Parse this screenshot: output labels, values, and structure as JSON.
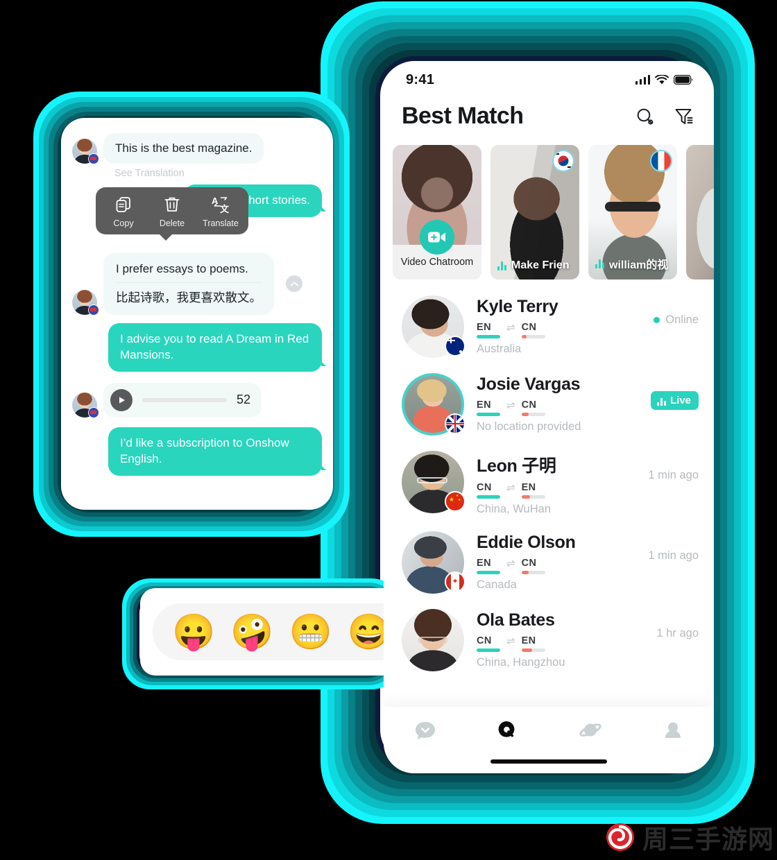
{
  "accent": {
    "teal": "#2AD5BE",
    "neon_cyan": "#18F0F6",
    "deep_teal": "#0B4B4B",
    "navy": "#0B1430",
    "red": "#F4796B"
  },
  "right_phone": {
    "status_bar": {
      "time": "9:41",
      "signal_icon": "cellular-signal-icon",
      "wifi_icon": "wifi-icon",
      "battery_icon": "battery-icon"
    },
    "header": {
      "title": "Best Match",
      "search_icon": "search-icon",
      "filter_icon": "filter-icon"
    },
    "stories": [
      {
        "label": "Video Chatroom",
        "type": "video-chatroom",
        "button_icon": "video-plus-icon",
        "flag": null,
        "live": false
      },
      {
        "label": "Make Frien",
        "type": "live",
        "flag": "kr",
        "live": true
      },
      {
        "label": "william的视",
        "type": "live",
        "flag": "fr",
        "live": true
      },
      {
        "label": "",
        "type": "partial",
        "flag": null,
        "live": false
      }
    ],
    "users": [
      {
        "name": "Kyle Terry",
        "from": "EN",
        "to": "CN",
        "from_level": 100,
        "to_level": 22,
        "location": "Australia",
        "status_type": "online",
        "status_text": "Online",
        "flag": "au",
        "ring": false
      },
      {
        "name": "Josie Vargas",
        "from": "EN",
        "to": "CN",
        "from_level": 100,
        "to_level": 30,
        "location": "No location provided",
        "status_type": "live",
        "status_text": "Live",
        "flag": "gb",
        "ring": true
      },
      {
        "name": "Leon 子明",
        "from": "CN",
        "to": "EN",
        "from_level": 100,
        "to_level": 38,
        "location": "China, WuHan",
        "status_type": "time",
        "status_text": "1 min ago",
        "flag": "cn",
        "ring": false
      },
      {
        "name": "Eddie Olson",
        "from": "EN",
        "to": "CN",
        "from_level": 100,
        "to_level": 30,
        "location": "Canada",
        "status_type": "time",
        "status_text": "1 min ago",
        "flag": "ca",
        "ring": false
      },
      {
        "name": "Ola Bates",
        "from": "CN",
        "to": "EN",
        "from_level": 100,
        "to_level": 45,
        "location": "China, Hangzhou",
        "status_type": "time",
        "status_text": "1 hr ago",
        "flag": "cn",
        "ring": false
      }
    ],
    "tabbar": [
      {
        "icon": "chat-bubble-icon",
        "active": false
      },
      {
        "icon": "search-circle-icon",
        "active": true
      },
      {
        "icon": "planet-icon",
        "active": false
      },
      {
        "icon": "profile-icon",
        "active": false
      }
    ]
  },
  "left_phone": {
    "messages": [
      {
        "kind": "incoming-text",
        "text": "This is the best magazine.",
        "see_translation": "See Translation"
      },
      {
        "kind": "outgoing-text",
        "text": "I like the short stories."
      },
      {
        "kind": "incoming-translated",
        "text": "I prefer essays to poems.",
        "translation": "比起诗歌，我更喜欢散文。",
        "collapse_icon": "chevron-up-icon"
      },
      {
        "kind": "outgoing-text",
        "text": "I advise you to read A Dream in Red Mansions."
      },
      {
        "kind": "incoming-voice",
        "duration": "52",
        "play_icon": "play-icon"
      },
      {
        "kind": "outgoing-text",
        "text": "I’d like a subscription to Onshow English."
      }
    ],
    "context_menu": [
      {
        "label": "Copy",
        "icon": "copy-icon"
      },
      {
        "label": "Delete",
        "icon": "trash-icon"
      },
      {
        "label": "Translate",
        "icon": "translate-icon"
      }
    ]
  },
  "emoji_bar": {
    "emojis": [
      {
        "name": "face-with-tongue-out-icon",
        "glyph": "😛"
      },
      {
        "name": "zany-face-icon",
        "glyph": "🤪"
      },
      {
        "name": "grimacing-face-icon",
        "glyph": "😬"
      },
      {
        "name": "grinning-squinting-face-icon",
        "glyph": "😄"
      }
    ]
  },
  "watermark": {
    "text": "周三手游网",
    "logo_icon": "spiral-logo-icon"
  }
}
